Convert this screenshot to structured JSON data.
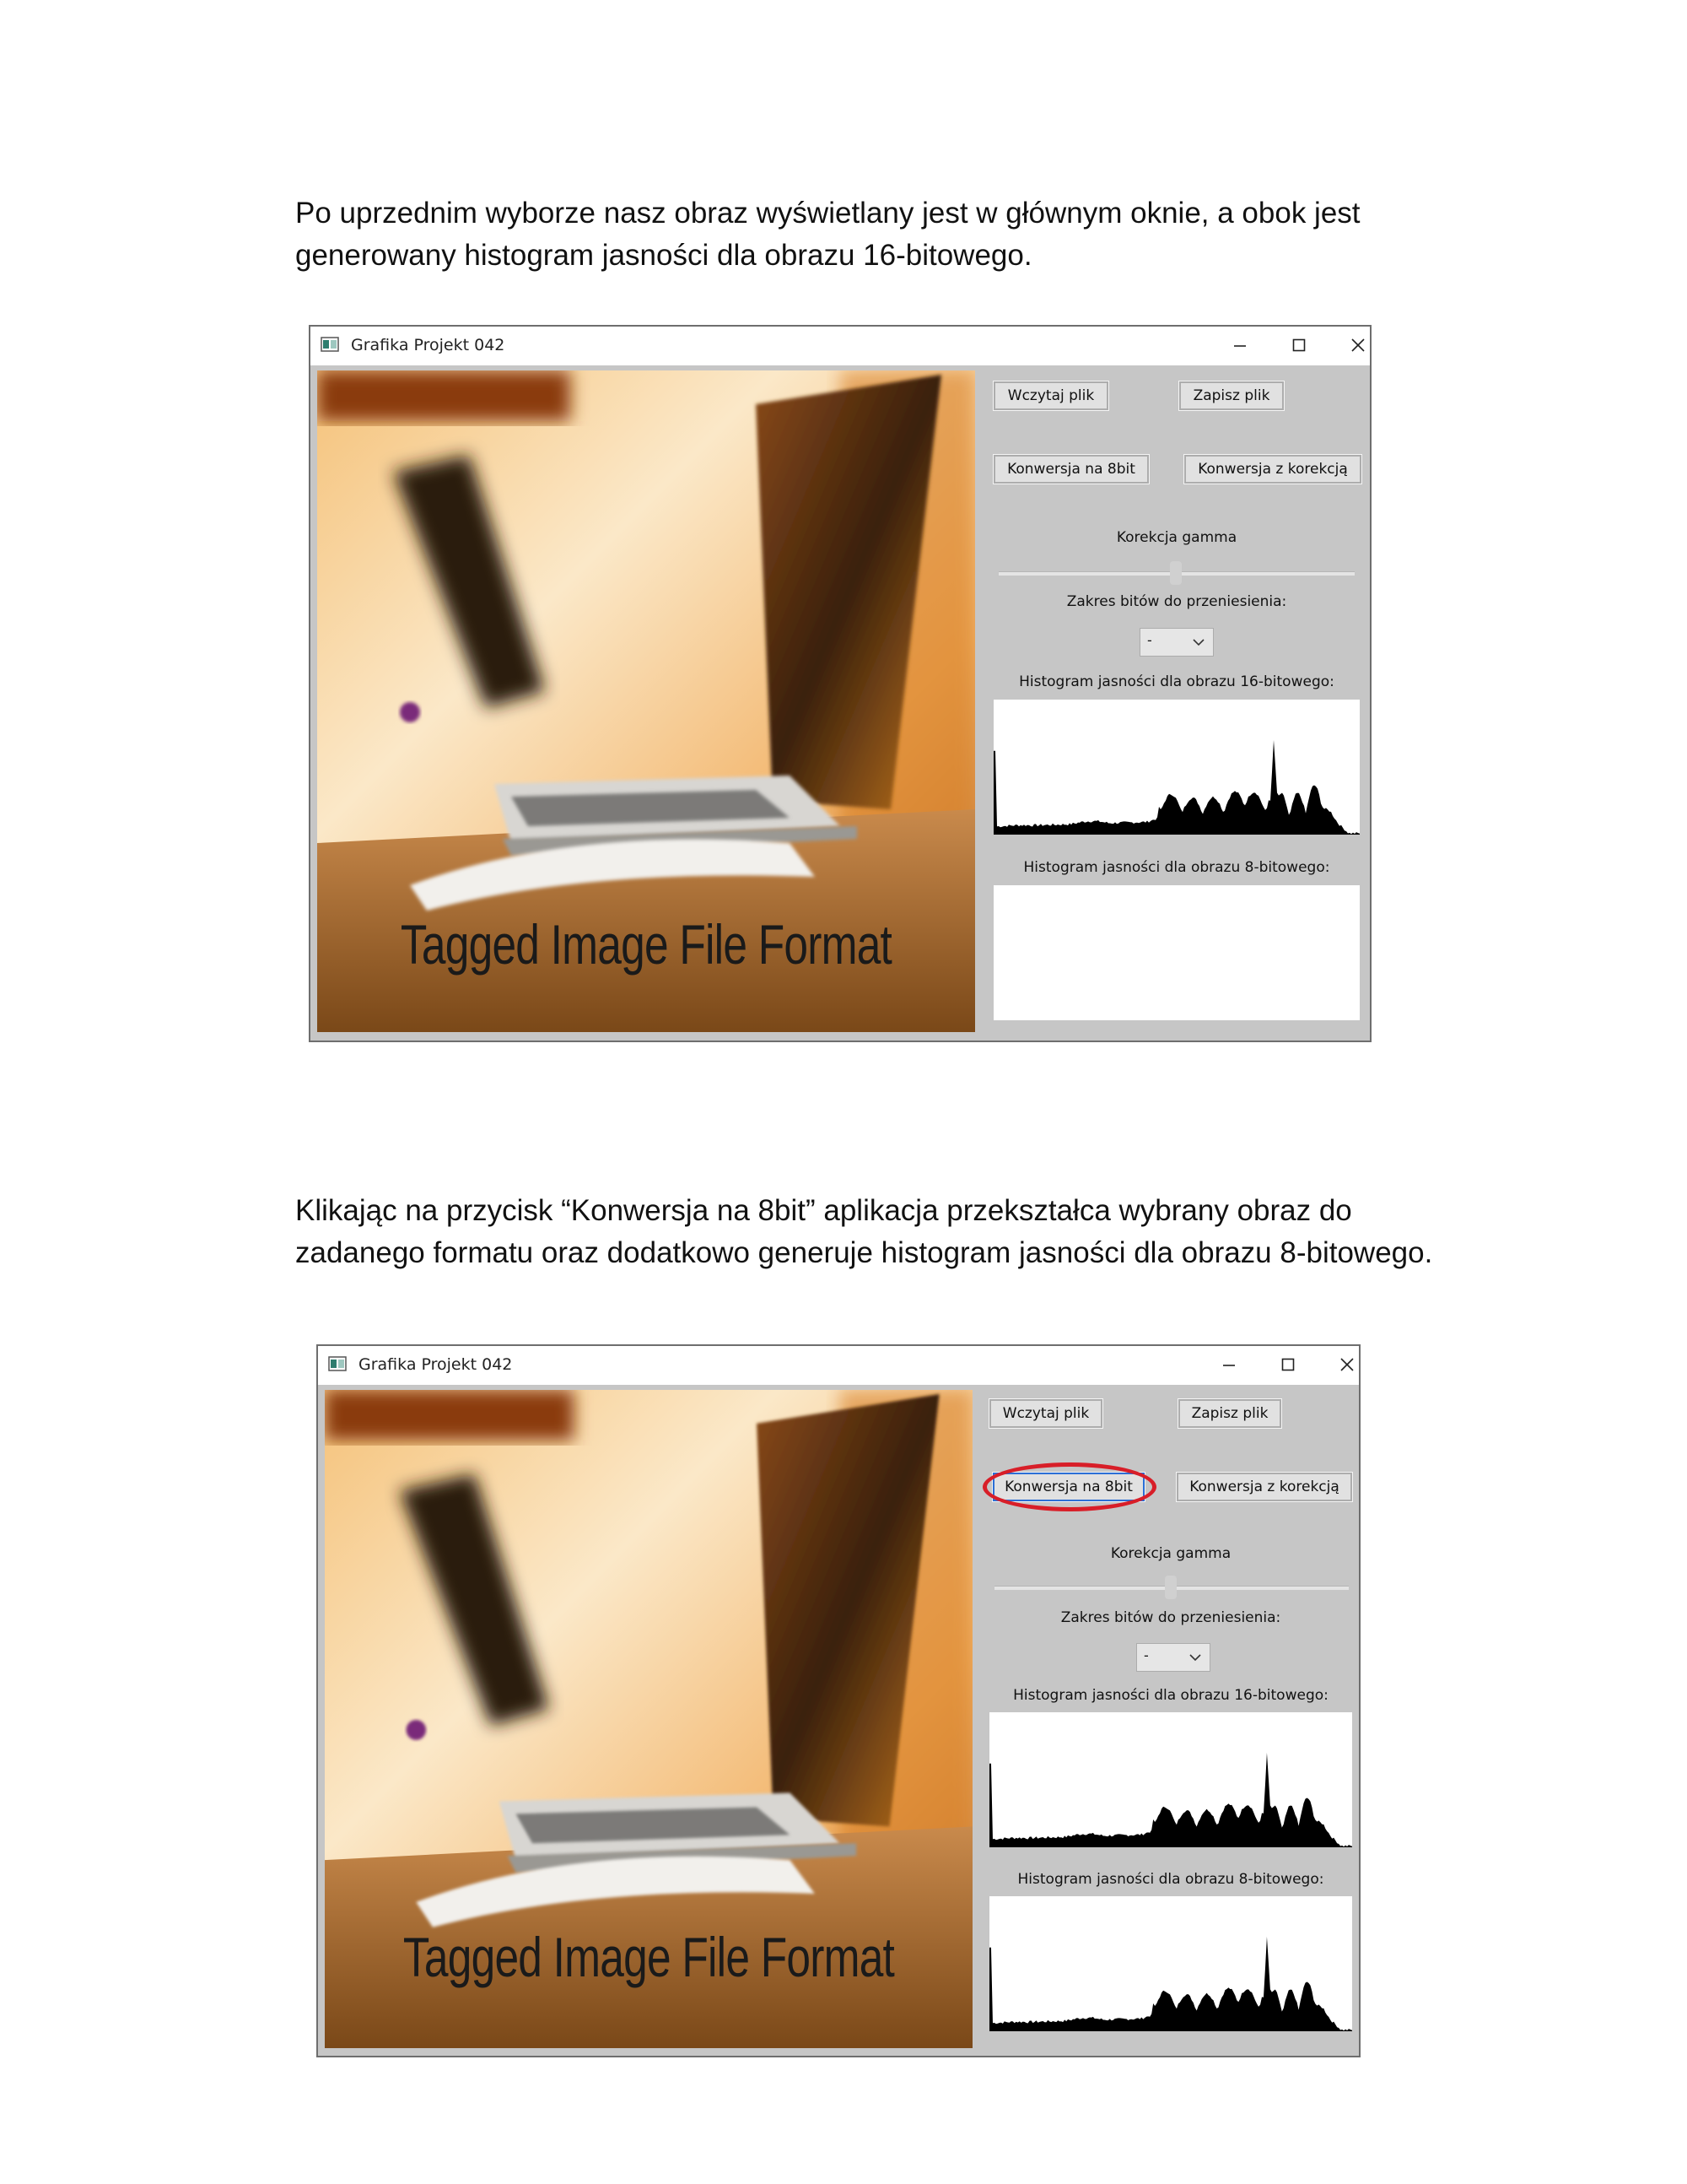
{
  "paragraphs": [
    {
      "lines": [
        "Po uprzednim wyborze nasz obraz wyświetlany jest w głównym oknie, a obok jest",
        "generowany histogram jasności dla obrazu 16-bitowego."
      ]
    },
    {
      "lines": [
        "Klikając na przycisk “Konwersja na 8bit” aplikacja przekształca wybrany obraz do",
        "zadanego formatu oraz dodatkowo generuje histogram jasności dla obrazu 8-bitowego."
      ]
    }
  ],
  "window_title": "Grafika Projekt 042",
  "buttons": {
    "load": "Wczytaj plik",
    "save": "Zapisz plik",
    "convert8": "Konwersja na 8bit",
    "convert_corr": "Konwersja z korekcją"
  },
  "labels": {
    "gamma": "Korekcja gamma",
    "bit_range": "Zakres bitów do przeniesienia:",
    "hist16": "Histogram jasności dla obrazu 16-bitowego:",
    "hist8": "Histogram jasności dla obrazu 8-bitowego:"
  },
  "combo_value": "-",
  "gamma_slider_position": 0.5,
  "image_caption": "Tagged Image File Format",
  "icons": {
    "app": "app-window-icon",
    "minimize": "minimize-icon",
    "maximize": "maximize-icon",
    "close": "close-icon",
    "combo": "chevron-down-icon"
  },
  "screens": [
    {
      "hist8_filled": false,
      "convert8_highlighted": false
    },
    {
      "hist8_filled": true,
      "convert8_highlighted": true
    }
  ],
  "colors": {
    "highlight": "#d81e28",
    "panel": "#c6c6c6"
  }
}
